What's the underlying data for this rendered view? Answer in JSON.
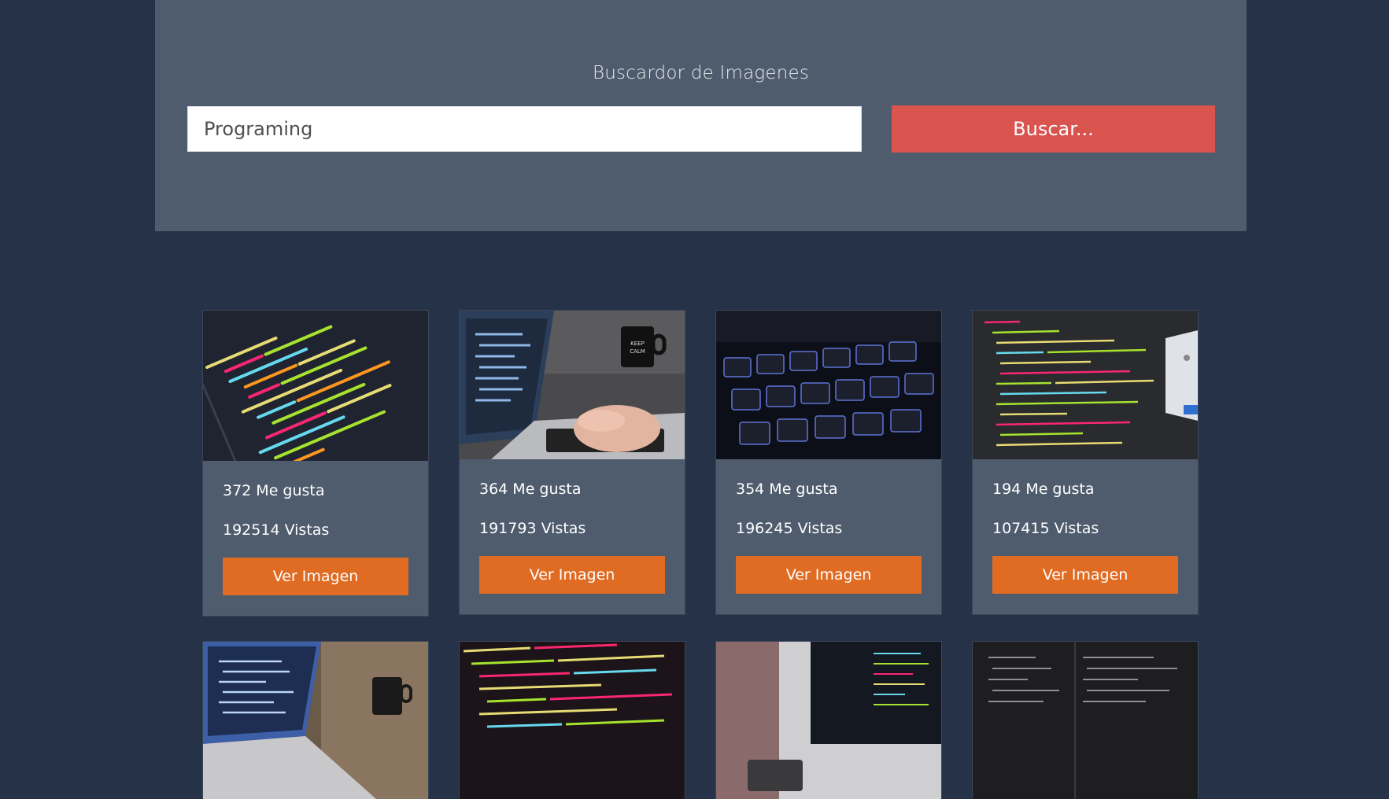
{
  "header": {
    "title": "Buscardor de Imagenes",
    "search_value": "Programing",
    "search_button": "Buscar..."
  },
  "colors": {
    "page_bg": "#263247",
    "panel_bg": "#4e5c6d",
    "search_button": "#d9534f",
    "card_button": "#e06b22"
  },
  "results": [
    {
      "likes": "372 Me gusta",
      "views": "192514 Vistas",
      "button": "Ver Imagen",
      "thumb": "code-screen"
    },
    {
      "likes": "364 Me gusta",
      "views": "191793 Vistas",
      "button": "Ver Imagen",
      "thumb": "laptop-typing"
    },
    {
      "likes": "354 Me gusta",
      "views": "196245 Vistas",
      "button": "Ver Imagen",
      "thumb": "keyboard"
    },
    {
      "likes": "194 Me gusta",
      "views": "107415 Vistas",
      "button": "Ver Imagen",
      "thumb": "code-editor"
    },
    {
      "thumb": "laptop-code"
    },
    {
      "thumb": "html-code"
    },
    {
      "thumb": "desk-monitor"
    },
    {
      "thumb": "dark-code"
    }
  ]
}
